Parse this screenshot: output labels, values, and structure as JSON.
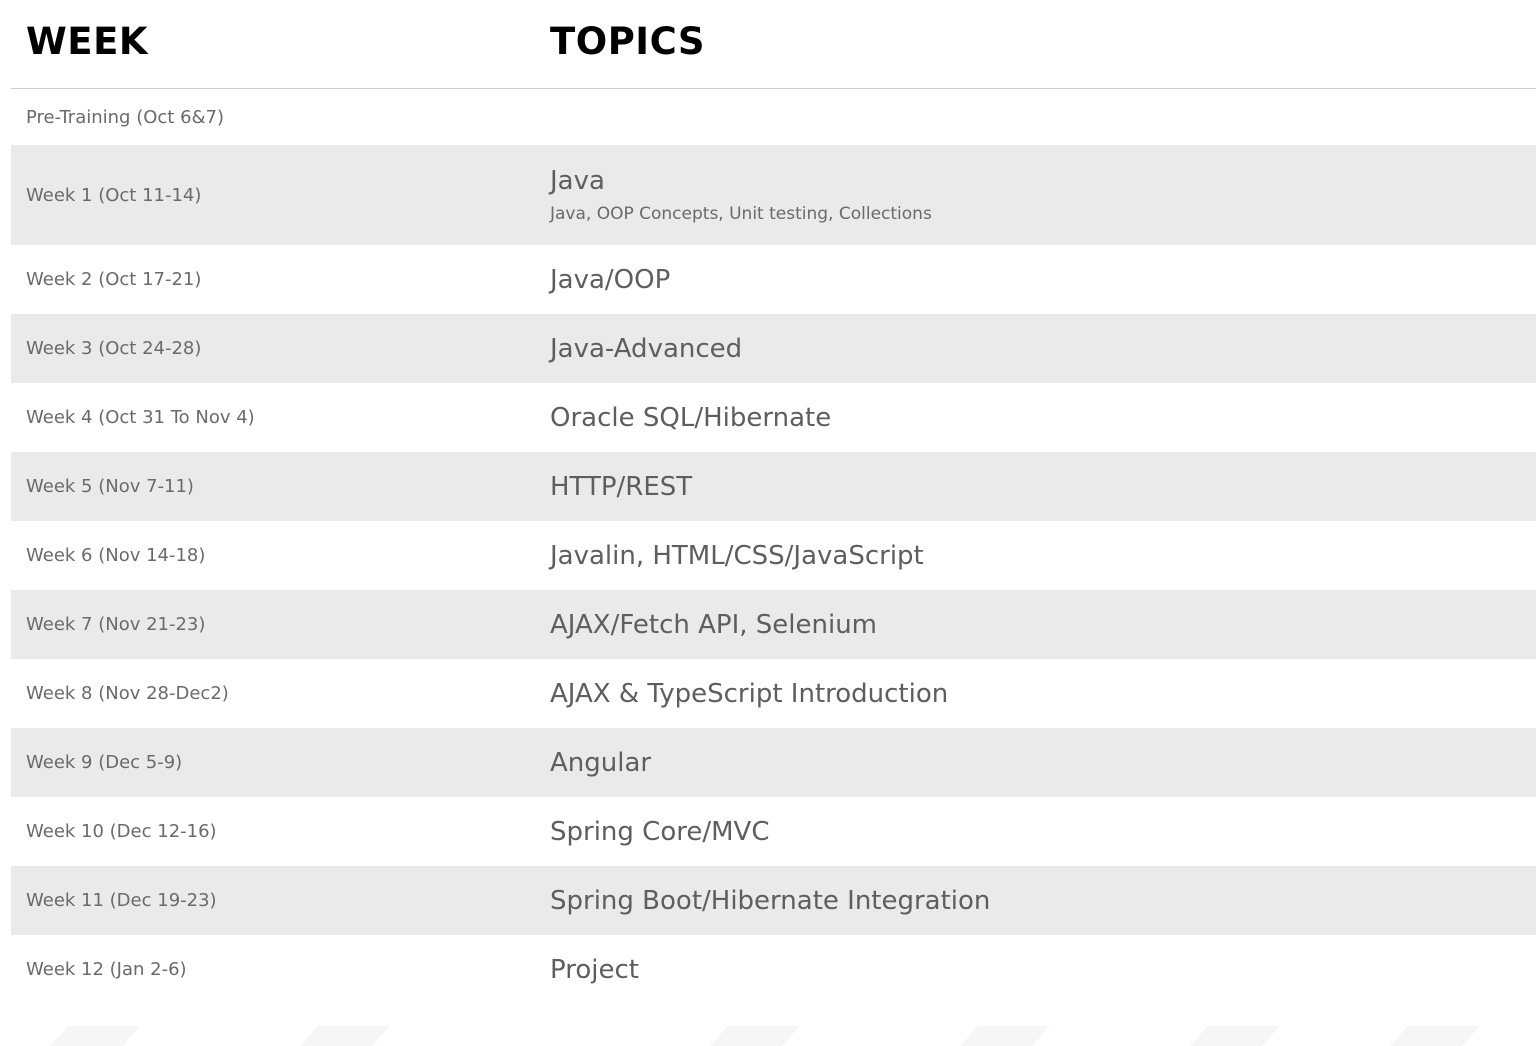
{
  "header": {
    "week_label": "WEEK",
    "topics_label": "TOPICS"
  },
  "rows": [
    {
      "week": "Pre-Training (Oct 6&7)",
      "topic": "",
      "detail": ""
    },
    {
      "week": "Week 1 (Oct 11-14)",
      "topic": "Java",
      "detail": "Java, OOP Concepts, Unit testing, Collections"
    },
    {
      "week": "Week 2 (Oct 17-21)",
      "topic": "Java/OOP",
      "detail": ""
    },
    {
      "week": "Week 3 (Oct 24-28)",
      "topic": "Java-Advanced",
      "detail": ""
    },
    {
      "week": "Week 4 (Oct 31 To Nov 4)",
      "topic": "Oracle SQL/Hibernate",
      "detail": ""
    },
    {
      "week": "Week 5 (Nov 7-11)",
      "topic": "HTTP/REST",
      "detail": ""
    },
    {
      "week": "Week 6 (Nov 14-18)",
      "topic": "Javalin, HTML/CSS/JavaScript",
      "detail": ""
    },
    {
      "week": "Week 7 (Nov 21-23)",
      "topic": "AJAX/Fetch API, Selenium",
      "detail": ""
    },
    {
      "week": "Week 8 (Nov 28-Dec2)",
      "topic": "AJAX & TypeScript Introduction",
      "detail": ""
    },
    {
      "week": "Week 9 (Dec 5-9)",
      "topic": "Angular",
      "detail": ""
    },
    {
      "week": "Week 10 (Dec 12-16)",
      "topic": "Spring Core/MVC",
      "detail": ""
    },
    {
      "week": "Week 11 (Dec 19-23)",
      "topic": "Spring Boot/Hibernate Integration",
      "detail": ""
    },
    {
      "week": "Week 12 (Jan 2-6)",
      "topic": "Project",
      "detail": ""
    }
  ]
}
